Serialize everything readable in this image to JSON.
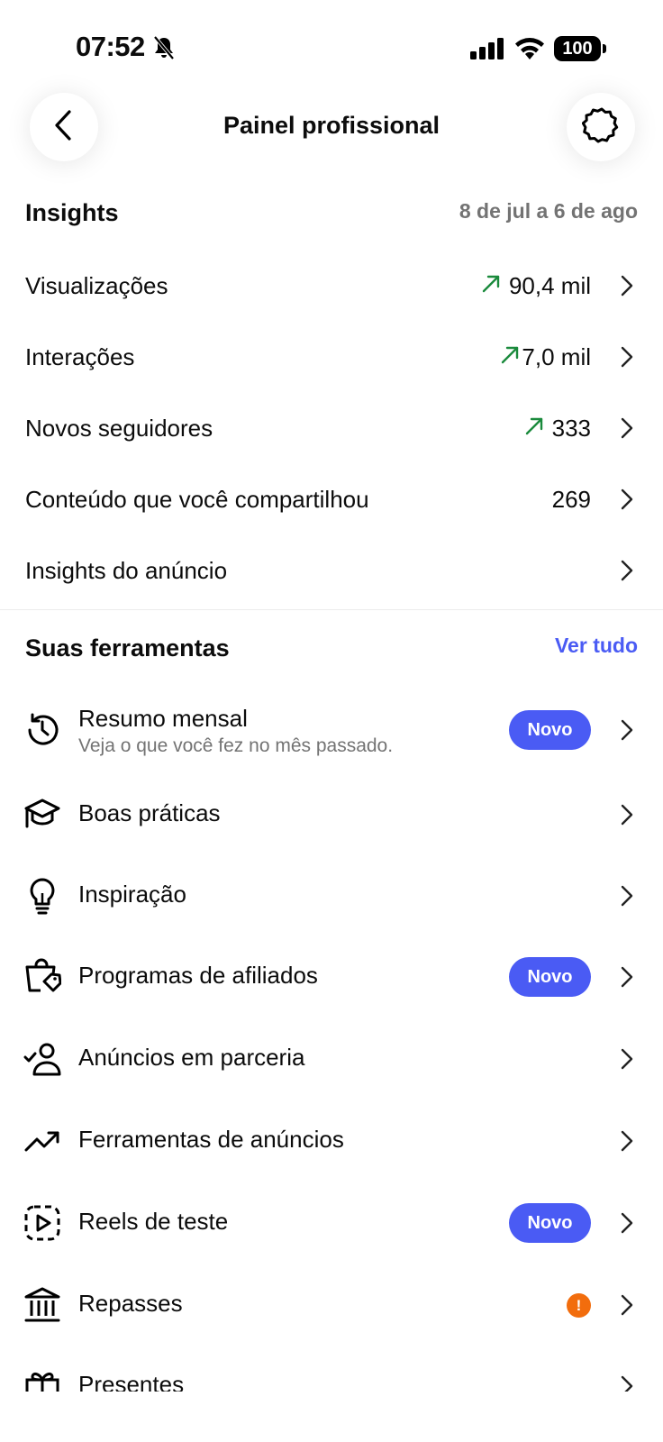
{
  "status_bar": {
    "time": "07:52",
    "battery": "100"
  },
  "header": {
    "title": "Painel profissional"
  },
  "insights": {
    "title": "Insights",
    "date_range": "8 de jul a 6 de ago",
    "rows": [
      {
        "label": "Visualizações",
        "value": "90,4 mil",
        "trend": "up"
      },
      {
        "label": "Interações",
        "value": "7,0 mil",
        "trend": "up"
      },
      {
        "label": "Novos seguidores",
        "value": "333",
        "trend": "up"
      },
      {
        "label": "Conteúdo que você compartilhou",
        "value": "269"
      },
      {
        "label": "Insights do anúncio",
        "value": ""
      }
    ]
  },
  "tools": {
    "title": "Suas ferramentas",
    "see_all": "Ver tudo",
    "items": [
      {
        "label": "Resumo mensal",
        "subtitle": "Veja o que você fez no mês passado.",
        "badge": "Novo",
        "icon": "history-icon"
      },
      {
        "label": "Boas práticas",
        "icon": "graduation-cap-icon"
      },
      {
        "label": "Inspiração",
        "icon": "lightbulb-icon"
      },
      {
        "label": "Programas de afiliados",
        "badge": "Novo",
        "icon": "shopping-bag-tag-icon"
      },
      {
        "label": "Anúncios em parceria",
        "icon": "person-check-icon"
      },
      {
        "label": "Ferramentas de anúncios",
        "icon": "trend-up-icon"
      },
      {
        "label": "Reels de teste",
        "badge": "Novo",
        "icon": "reels-dashed-icon"
      },
      {
        "label": "Repasses",
        "alert": "!",
        "icon": "bank-icon"
      },
      {
        "label": "Presentes",
        "icon": "gift-icon"
      }
    ]
  },
  "colors": {
    "accent": "#4a5bf4",
    "trend_green": "#1a8a3c",
    "alert_orange": "#f26d0d",
    "muted": "#737373"
  }
}
